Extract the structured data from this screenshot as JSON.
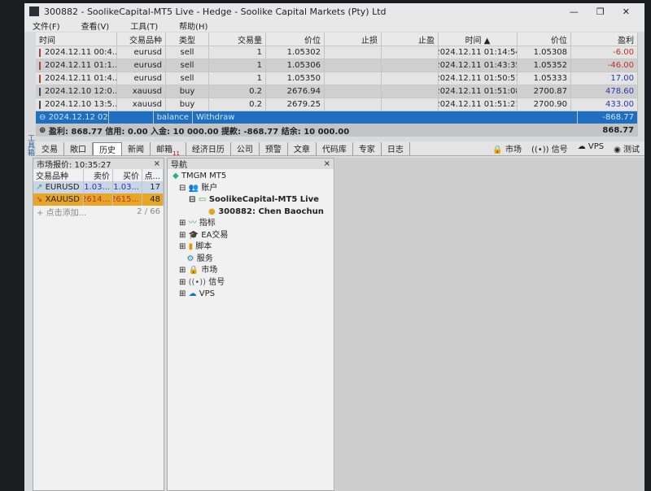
{
  "window": {
    "title": "300882 - SoolikeCapital-MT5 Live - Hedge - Soolike Capital Markets (Pty) Ltd",
    "controls": [
      "—",
      "❐",
      "✕"
    ]
  },
  "menu": [
    "文件(F)",
    "查看(V)",
    "工具(T)",
    "帮助(H)"
  ],
  "table": {
    "headers": [
      "时间",
      "交易品种",
      "类型",
      "交易量",
      "价位",
      "止损",
      "止盈",
      "时间 ▲",
      "价位",
      "盈利"
    ],
    "rows": [
      {
        "time": "2024.12.11 00:4...",
        "symbol": "eurusd",
        "type": "sell",
        "volume": "1",
        "price": "1.05302",
        "sl": "",
        "tp": "",
        "close_time": "2024.12.11 01:14:54",
        "close_price": "1.05308",
        "profit": "-6.00",
        "kind": "neg"
      },
      {
        "time": "2024.12.11 01:1...",
        "symbol": "eurusd",
        "type": "sell",
        "volume": "1",
        "price": "1.05306",
        "sl": "",
        "tp": "",
        "close_time": "2024.12.11 01:43:35",
        "close_price": "1.05352",
        "profit": "-46.00",
        "kind": "neg"
      },
      {
        "time": "2024.12.11 01:4...",
        "symbol": "eurusd",
        "type": "sell",
        "volume": "1",
        "price": "1.05350",
        "sl": "",
        "tp": "",
        "close_time": "2024.12.11 01:50:51",
        "close_price": "1.05333",
        "profit": "17.00",
        "kind": "pos"
      },
      {
        "time": "2024.12.10 12:0...",
        "symbol": "xauusd",
        "type": "buy",
        "volume": "0.2",
        "price": "2676.94",
        "sl": "",
        "tp": "",
        "close_time": "2024.12.11 01:51:08",
        "close_price": "2700.87",
        "profit": "478.60",
        "kind": "pos"
      },
      {
        "time": "2024.12.10 13:5...",
        "symbol": "xauusd",
        "type": "buy",
        "volume": "0.2",
        "price": "2679.25",
        "sl": "",
        "tp": "",
        "close_time": "2024.12.11 01:51:21",
        "close_price": "2700.90",
        "profit": "433.00",
        "kind": "pos"
      }
    ],
    "selected": {
      "time": "2024.12.12 02:4...",
      "type": "balance",
      "comment": "Withdraw",
      "profit": "-868.77"
    },
    "summary": {
      "text": "盈利: 868.77  信用: 0.00  入金: 10 000.00  提款: -868.77  结余: 10 000.00",
      "total": "868.77"
    }
  },
  "toolbox_label": "工具箱",
  "tabs": [
    {
      "label": "交易"
    },
    {
      "label": "敞口"
    },
    {
      "label": "历史",
      "active": true
    },
    {
      "label": "新闻"
    },
    {
      "label": "邮箱",
      "badge": "11"
    },
    {
      "label": "经济日历"
    },
    {
      "label": "公司"
    },
    {
      "label": "预警"
    },
    {
      "label": "文章"
    },
    {
      "label": "代码库"
    },
    {
      "label": "专家"
    },
    {
      "label": "日志"
    }
  ],
  "status_links": [
    "市场",
    "信号",
    "VPS",
    "测试"
  ],
  "market_watch": {
    "title": "市场报价: 10:35:27",
    "headers": [
      "交易品种",
      "卖价",
      "买价",
      "点..."
    ],
    "rows": [
      {
        "symbol": "EURUSD",
        "bid": "1.03...",
        "ask": "1.03...",
        "spread": "17"
      },
      {
        "symbol": "XAUUSD",
        "bid": "2614...",
        "ask": "2615...",
        "spread": "48"
      }
    ],
    "add": "点击添加...",
    "count": "2 / 66"
  },
  "navigator": {
    "title": "导航",
    "root": "TMGM MT5",
    "accounts": "账户",
    "server": "SoolikeCapital-MT5 Live",
    "account": "300882: Chen Baochun",
    "items": [
      "指标",
      "EA交易",
      "脚本",
      "服务",
      "市场",
      "信号",
      "VPS"
    ]
  },
  "colors": {
    "selected": "#1f6fc0",
    "negative": "#c0302b",
    "positive": "#2a36b8",
    "highlight_row": "#e8a626"
  }
}
